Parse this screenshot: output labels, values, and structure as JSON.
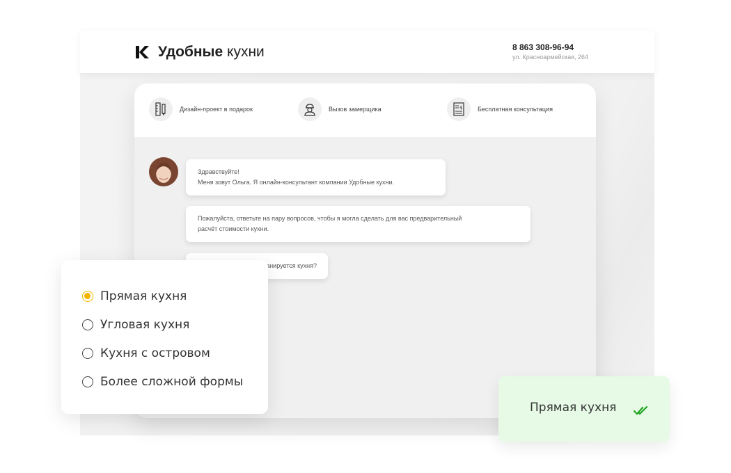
{
  "header": {
    "brand_bold": "Удобные",
    "brand_light": "кухни",
    "phone": "8 863 308-96-94",
    "address": "ул. Красноармейская, 264"
  },
  "services": [
    {
      "label": "Дизайн-проект в подарок",
      "icon": "ruler-pencil-icon"
    },
    {
      "label": "Вызов замерщика",
      "icon": "worker-helmet-icon"
    },
    {
      "label": "Бесплатная консультация",
      "icon": "price-list-icon"
    }
  ],
  "chat": {
    "messages": [
      {
        "lines": [
          "Здравствуйте!",
          "Меня зовут Ольга. Я онлайн-консультант компании Удобные кухни."
        ]
      },
      {
        "lines": [
          "Пожалуйста, ответьте на пару вопросов, чтобы я могла сделать для вас предварительный",
          "расчёт стоимости кухни."
        ]
      },
      {
        "lines": [
          "Какая форма планируется кухня?"
        ]
      }
    ]
  },
  "options": {
    "selected_index": 0,
    "items": [
      "Прямая кухня",
      "Угловая кухня",
      "Кухня с островом",
      "Более сложной формы"
    ]
  },
  "answer": {
    "text": "Прямая кухня",
    "icon": "double-check-icon"
  },
  "colors": {
    "accent": "#f5b400",
    "answer_bg": "#e6fae6",
    "check": "#1fa31f"
  }
}
